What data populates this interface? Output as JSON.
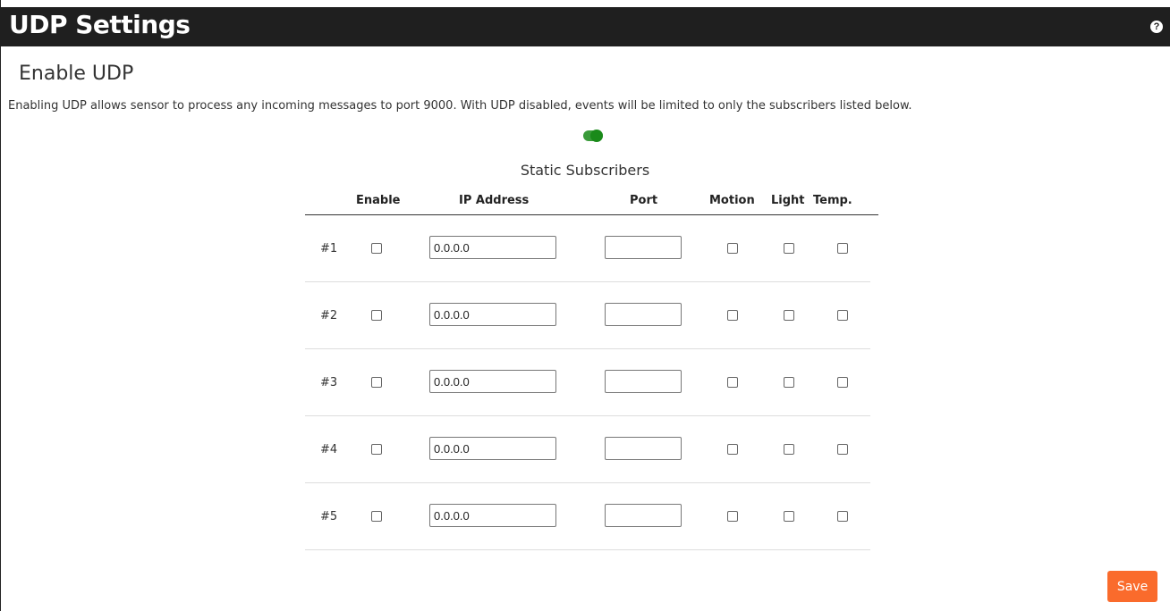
{
  "header": {
    "title": "UDP Settings",
    "help_icon": "help-circle-icon"
  },
  "enable_section": {
    "title": "Enable UDP",
    "description": "Enabling UDP allows sensor to process any incoming messages to port 9000. With UDP disabled, events will be limited to only the subscribers listed below.",
    "toggle_on": true,
    "toggle_color": "#3a9b3a"
  },
  "subscribers": {
    "title": "Static Subscribers",
    "columns": [
      "Enable",
      "IP Address",
      "Port",
      "Motion",
      "Light",
      "Temp."
    ],
    "rows": [
      {
        "num": "#1",
        "ip": "0.0.0.0",
        "port": ""
      },
      {
        "num": "#2",
        "ip": "0.0.0.0",
        "port": ""
      },
      {
        "num": "#3",
        "ip": "0.0.0.0",
        "port": ""
      },
      {
        "num": "#4",
        "ip": "0.0.0.0",
        "port": ""
      },
      {
        "num": "#5",
        "ip": "0.0.0.0",
        "port": ""
      }
    ]
  },
  "actions": {
    "save_label": "Save",
    "save_color": "#fa6b2c"
  }
}
